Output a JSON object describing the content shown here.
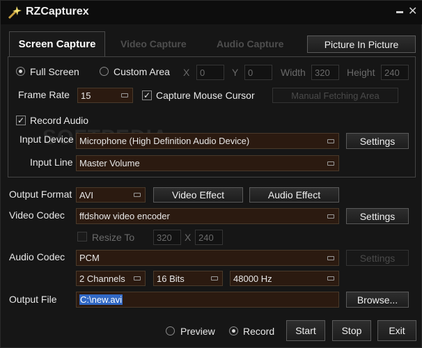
{
  "app": {
    "title": "RZCapturex"
  },
  "tabs": [
    {
      "label": "Screen Capture"
    },
    {
      "label": "Video Capture"
    },
    {
      "label": "Audio Capture"
    }
  ],
  "pip_button": "Picture In Picture",
  "capture": {
    "full_screen": "Full Screen",
    "custom_area": "Custom Area",
    "x_label": "X",
    "x_value": "0",
    "y_label": "Y",
    "y_value": "0",
    "width_label": "Width",
    "width_value": "320",
    "height_label": "Height",
    "height_value": "240",
    "frame_rate_label": "Frame Rate",
    "frame_rate_value": "15",
    "mouse_cursor": "Capture Mouse Cursor",
    "manual_fetch": "Manual Fetching Area",
    "record_audio": "Record Audio",
    "input_device_label": "Input Device",
    "input_device_value": "Microphone (High Definition Audio Device)",
    "input_line_label": "Input Line",
    "input_line_value": "Master Volume",
    "settings": "Settings"
  },
  "watermark": "SOFTPEDIA",
  "output": {
    "format_label": "Output Format",
    "format_value": "AVI",
    "video_effect": "Video Effect",
    "audio_effect": "Audio Effect",
    "video_codec_label": "Video Codec",
    "video_codec_value": "ffdshow video encoder",
    "resize_label": "Resize To",
    "resize_w": "320",
    "resize_x": "X",
    "resize_h": "240",
    "audio_codec_label": "Audio Codec",
    "audio_codec_value": "PCM",
    "channels": "2 Channels",
    "bits": "16 Bits",
    "rate": "48000 Hz",
    "file_label": "Output File",
    "file_value": "C:\\new.avi",
    "browse": "Browse...",
    "settings": "Settings"
  },
  "footer": {
    "preview": "Preview",
    "record": "Record",
    "start": "Start",
    "stop": "Stop",
    "exit": "Exit"
  }
}
